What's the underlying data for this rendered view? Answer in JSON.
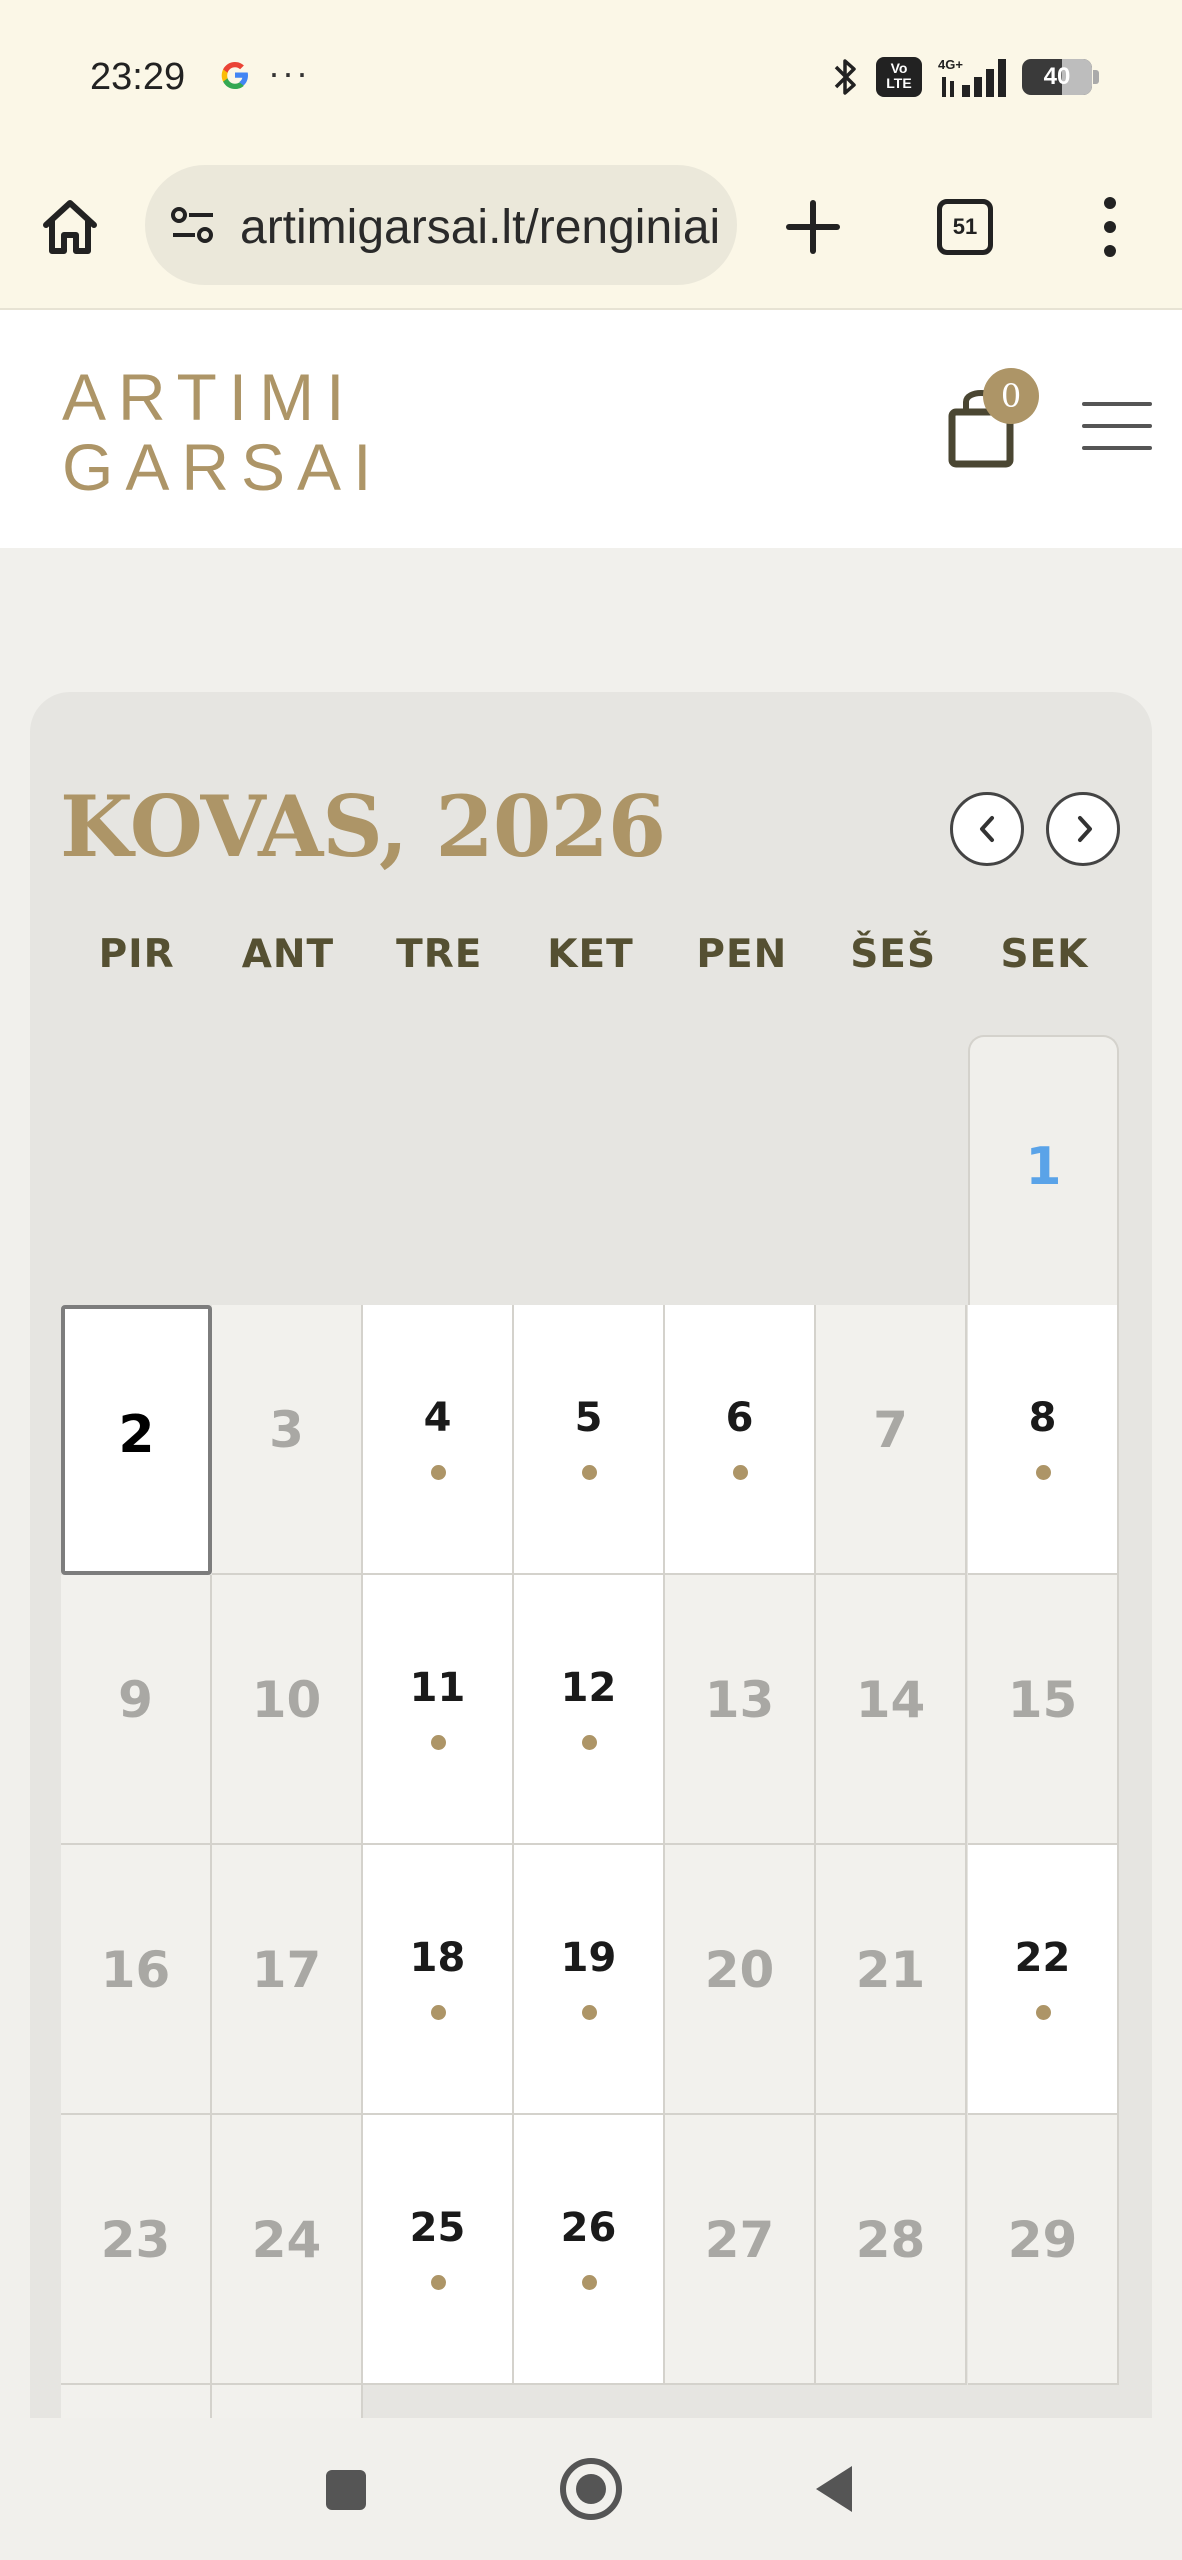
{
  "status_bar": {
    "time": "23:29",
    "dots": "···",
    "volte": "Vo LTE",
    "network": "4G+",
    "battery": "40"
  },
  "browser": {
    "url": "artimigarsai.lt/renginiai",
    "tab_count": "51"
  },
  "site": {
    "logo_line1": "ARTIMI",
    "logo_line2": "GARSAI",
    "cart_count": "0"
  },
  "calendar": {
    "title": "KOVAS, 2026",
    "weekdays": [
      "PIR",
      "ANT",
      "TRE",
      "KET",
      "PEN",
      "ŠEŠ",
      "SEK"
    ],
    "days": {
      "d1": "1",
      "d2": "2",
      "d3": "3",
      "d4": "4",
      "d5": "5",
      "d6": "6",
      "d7": "7",
      "d8": "8",
      "d9": "9",
      "d10": "10",
      "d11": "11",
      "d12": "12",
      "d13": "13",
      "d14": "14",
      "d15": "15",
      "d16": "16",
      "d17": "17",
      "d18": "18",
      "d19": "19",
      "d20": "20",
      "d21": "21",
      "d22": "22",
      "d23": "23",
      "d24": "24",
      "d25": "25",
      "d26": "26",
      "d27": "27",
      "d28": "28",
      "d29": "29"
    },
    "event_days": [
      4,
      5,
      6,
      8,
      11,
      12,
      18,
      19,
      22,
      25,
      26
    ],
    "today": 2
  },
  "colors": {
    "accent": "#ad9567",
    "header_bg": "#fbf7e7",
    "today_link": "#5aa3e8"
  }
}
